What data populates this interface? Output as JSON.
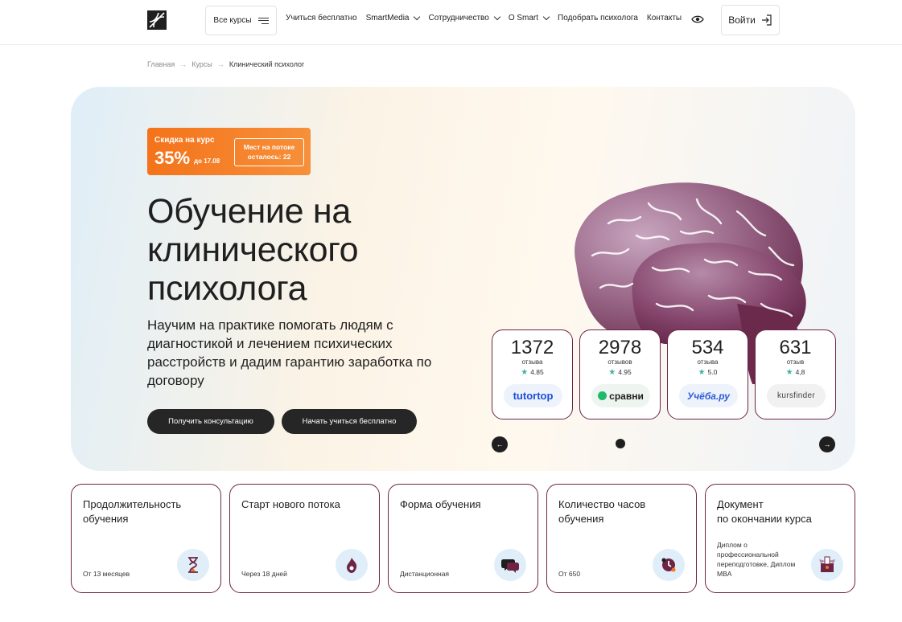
{
  "header": {
    "all_courses": "Все курсы",
    "nav": [
      {
        "label": "Учиться бесплатно",
        "has_dropdown": false
      },
      {
        "label": "SmartMedia",
        "has_dropdown": true
      },
      {
        "label": "Сотрудничество",
        "has_dropdown": true
      },
      {
        "label": "О Smart",
        "has_dropdown": true
      },
      {
        "label": "Подобрать психолога",
        "has_dropdown": false
      },
      {
        "label": "Контакты",
        "has_dropdown": false
      }
    ],
    "login": "Войти"
  },
  "breadcrumb": {
    "home": "Главная",
    "courses": "Курсы",
    "current": "Клинический психолог",
    "separator": "→"
  },
  "hero": {
    "discount_label": "Скидка на курс",
    "discount_percent": "35%",
    "discount_until": "до 17.08",
    "seats_left": "Мест на потоке осталось: 22",
    "title": "Обучение на клинического психолога",
    "subtitle": "Научим на практике помогать людям с диагностикой и лечением психических расстройств и дадим гарантию заработка по договору",
    "btn_consult": "Получить консультацию",
    "btn_free": "Начать учиться бесплатно"
  },
  "reviews": [
    {
      "count": "1372",
      "word": "отзыва",
      "rating": "4.85",
      "site": "tutortop"
    },
    {
      "count": "2978",
      "word": "отзывов",
      "rating": "4.95",
      "site": "сравни"
    },
    {
      "count": "534",
      "word": "отзыва",
      "rating": "5.0",
      "site": "Учёба.ру"
    },
    {
      "count": "631",
      "word": "отзыв",
      "rating": "4,8",
      "site": "kursfinder"
    }
  ],
  "carousel": {
    "prev": "←",
    "next": "→"
  },
  "info": [
    {
      "title": "Продолжительность обучения",
      "value": "От 13 месяцев",
      "icon": "hourglass-icon"
    },
    {
      "title": "Старт нового потока",
      "value": "Через 18 дней",
      "icon": "flame-icon"
    },
    {
      "title": "Форма обучения",
      "value": "Дистанционная",
      "icon": "chat-bubbles-icon"
    },
    {
      "title": "Количество часов обучения",
      "value": "От 650",
      "icon": "clock-icon"
    },
    {
      "title": "Документ\nпо окончании курса",
      "value": "Диплом о профессиональной переподготовке, Диплом MBA",
      "icon": "diploma-box-icon"
    }
  ],
  "colors": {
    "accent_orange": "#f4731a",
    "card_border": "#6e2445",
    "dark_button": "#262626",
    "rating_star": "#3fb39d",
    "icon_bg": "#dfeef8"
  }
}
